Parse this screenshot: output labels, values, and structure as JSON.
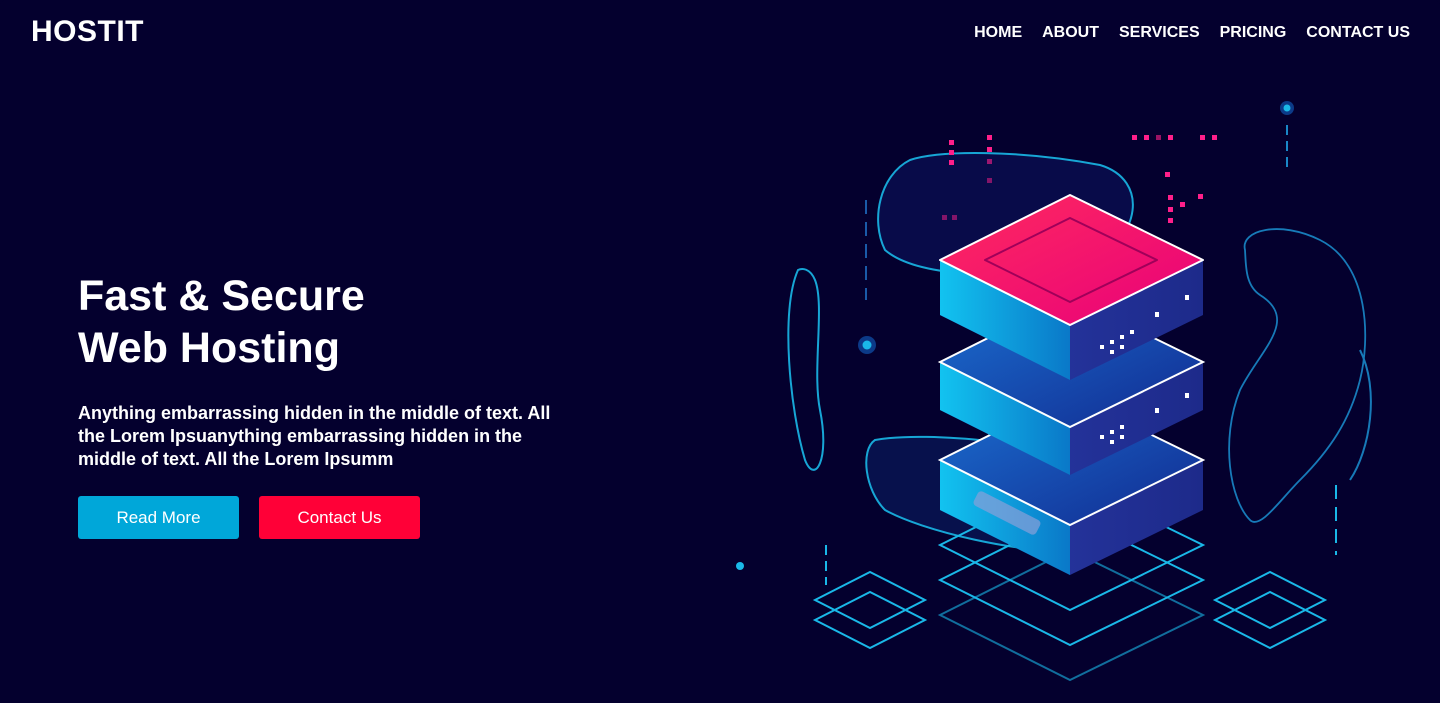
{
  "brand": {
    "name": "HOSTIT"
  },
  "nav": {
    "items": [
      "HOME",
      "ABOUT",
      "SERVICES",
      "PRICING",
      "CONTACT US"
    ]
  },
  "hero": {
    "title_line1": "Fast & Secure",
    "title_line2": "Web Hosting",
    "description": "Anything embarrassing hidden in the middle of text. All the Lorem Ipsuanything embarrassing hidden in the middle of text. All the Lorem Ipsumm",
    "read_more_label": "Read More",
    "contact_label": "Contact Us"
  },
  "colors": {
    "background": "#04002e",
    "primary_button": "#00a7d9",
    "secondary_button": "#ff0037",
    "accent_pink": "#ff1f63",
    "accent_cyan": "#1ab8e8"
  },
  "illustration": {
    "icon": "server-stack-illustration"
  }
}
